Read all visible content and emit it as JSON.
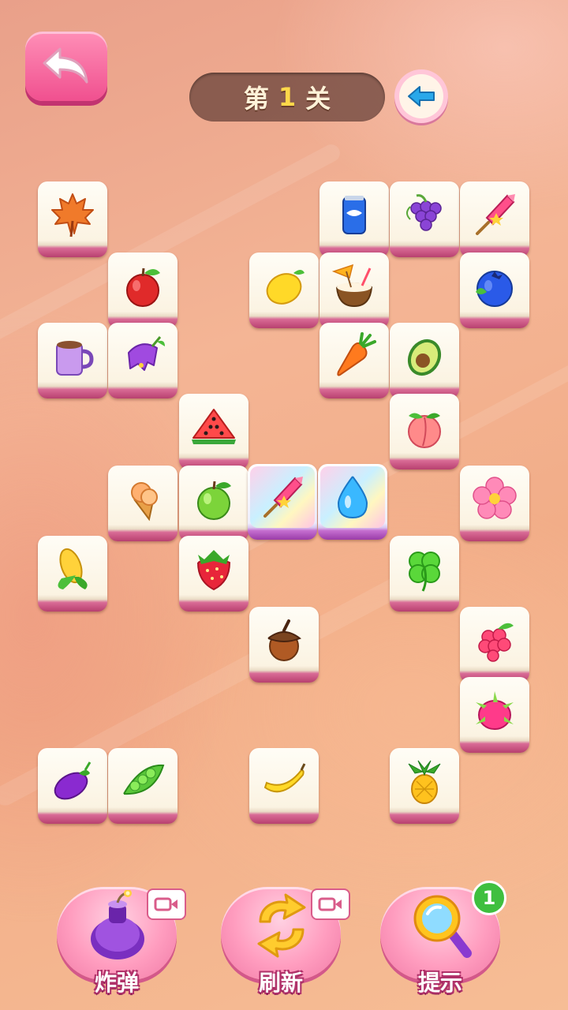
{
  "header": {
    "level_prefix": "第",
    "level_number": "1",
    "level_suffix": "关"
  },
  "board": {
    "tiles": [
      {
        "icon": "maple-leaf-icon",
        "selected": false
      },
      {
        "icon": "soda-can-icon",
        "selected": false
      },
      {
        "icon": "grapes-icon",
        "selected": false
      },
      {
        "icon": "firework-rocket-icon",
        "selected": false
      },
      {
        "icon": "apple-icon",
        "selected": false
      },
      {
        "icon": "lemon-icon",
        "selected": false
      },
      {
        "icon": "coconut-drink-icon",
        "selected": false
      },
      {
        "icon": "blueberry-icon",
        "selected": false
      },
      {
        "icon": "cocoa-mug-icon",
        "selected": false
      },
      {
        "icon": "bellflower-icon",
        "selected": false
      },
      {
        "icon": "carrot-icon",
        "selected": false
      },
      {
        "icon": "avocado-icon",
        "selected": false
      },
      {
        "icon": "watermelon-slice-icon",
        "selected": false
      },
      {
        "icon": "peach-icon",
        "selected": false
      },
      {
        "icon": "ice-cream-cone-icon",
        "selected": false
      },
      {
        "icon": "green-apple-icon",
        "selected": false
      },
      {
        "icon": "firework-rocket-icon",
        "selected": true
      },
      {
        "icon": "water-drop-icon",
        "selected": true
      },
      {
        "icon": "pink-flower-icon",
        "selected": false
      },
      {
        "icon": "corn-icon",
        "selected": false
      },
      {
        "icon": "strawberry-icon",
        "selected": false
      },
      {
        "icon": "clover-icon",
        "selected": false
      },
      {
        "icon": "acorn-icon",
        "selected": false
      },
      {
        "icon": "raspberry-icon",
        "selected": false
      },
      {
        "icon": "dragon-fruit-icon",
        "selected": false
      },
      {
        "icon": "eggplant-icon",
        "selected": false
      },
      {
        "icon": "pea-pod-icon",
        "selected": false
      },
      {
        "icon": "banana-icon",
        "selected": false
      },
      {
        "icon": "pineapple-icon",
        "selected": false
      }
    ]
  },
  "tools": {
    "bomb": {
      "label": "炸弹",
      "icon": "bomb-icon",
      "badge_icon": "video-icon"
    },
    "refresh": {
      "label": "刷新",
      "icon": "refresh-icon",
      "badge_icon": "video-icon"
    },
    "hint": {
      "label": "提示",
      "icon": "magnifier-icon",
      "count": "1"
    }
  }
}
